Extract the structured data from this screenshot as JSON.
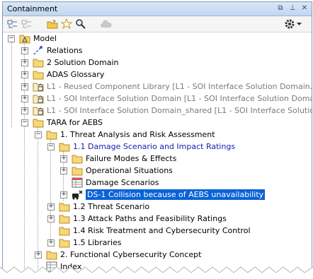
{
  "panel": {
    "title": "Containment"
  },
  "toolbar": {
    "icons": [
      "collapse-all-icon",
      "expand-all-icon",
      "open-folder-icon",
      "star-icon",
      "search-icon",
      "cloud-icon",
      "gear-icon",
      "dropdown-icon"
    ]
  },
  "tree": [
    {
      "label": "Model",
      "style": "normal"
    },
    {
      "label": "Relations",
      "style": "normal"
    },
    {
      "label": "2 Solution Domain",
      "style": "normal"
    },
    {
      "label": "ADAS Glossary",
      "style": "normal"
    },
    {
      "label": "L1 - Reused Component Library [L1 - SOI Interface Solution Domain.m",
      "style": "grey"
    },
    {
      "label": "L1 - SOI Interface Solution Domain [L1 - SOI Interface Solution Domain",
      "style": "grey"
    },
    {
      "label": "L1 - SOI Interface Solution Domain_shared [L1 - SOI Interface Solution",
      "style": "grey"
    },
    {
      "label": "TARA for AEBS",
      "style": "normal"
    },
    {
      "label": "1. Threat Analysis and Risk Assessment",
      "style": "normal"
    },
    {
      "label": "1.1 Damage Scenario and Impact Ratings",
      "style": "blue"
    },
    {
      "label": "Failure Modes & Effects",
      "style": "normal"
    },
    {
      "label": "Operational Situations",
      "style": "normal"
    },
    {
      "label": "Damage Scenarios",
      "style": "normal"
    },
    {
      "label": "DS-1 Collision because of AEBS unavailability",
      "style": "selected"
    },
    {
      "label": "1.2 Threat Scenario",
      "style": "normal"
    },
    {
      "label": "1.3 Attack Paths and Feasibility Ratings",
      "style": "normal"
    },
    {
      "label": "1.4 Risk Treatment and Cybersecurity Control",
      "style": "normal"
    },
    {
      "label": "1.5 Libraries",
      "style": "normal"
    },
    {
      "label": "2. Functional Cybersecurity Concept",
      "style": "normal"
    },
    {
      "label": "Index",
      "style": "normal"
    }
  ]
}
